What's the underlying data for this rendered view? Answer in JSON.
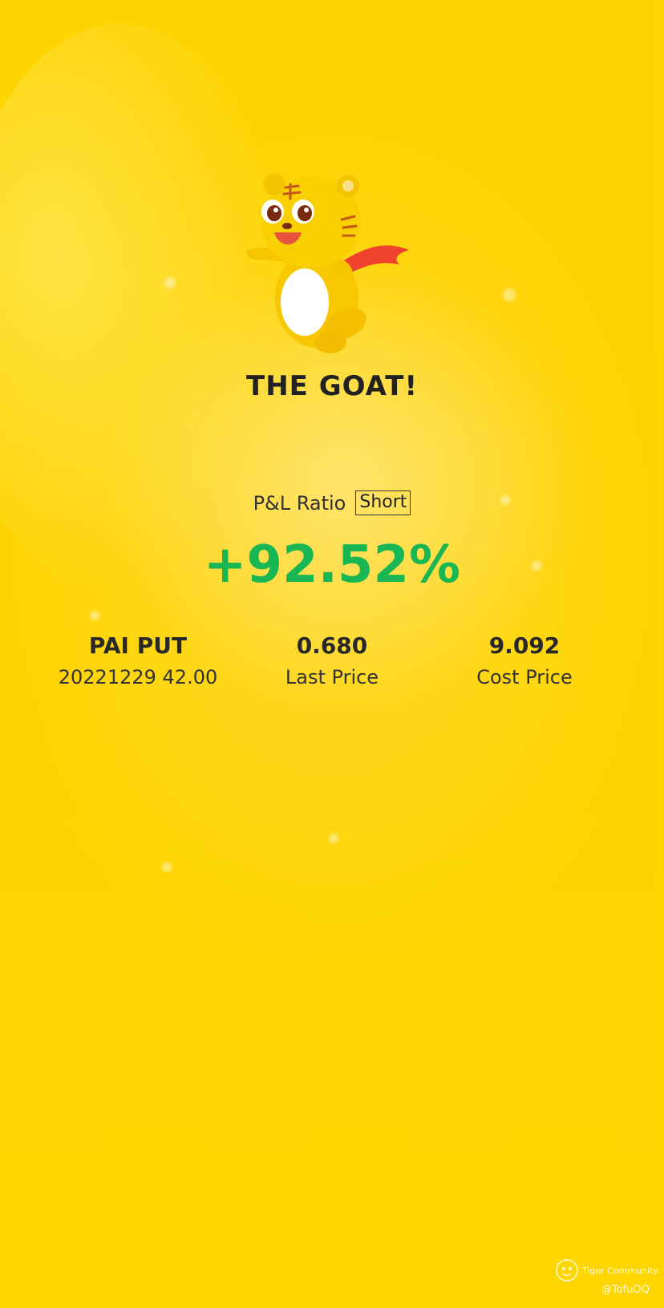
{
  "header": {
    "title": "THE GOAT!"
  },
  "pl": {
    "label": "P&L Ratio",
    "badge": "Short",
    "value": "+92.52%"
  },
  "stats": {
    "contract": {
      "name": "PAI PUT",
      "detail": "20221229 42.00"
    },
    "last_price": {
      "value": "0.680",
      "label": "Last Price"
    },
    "cost_price": {
      "value": "9.092",
      "label": "Cost Price"
    }
  },
  "footer": {
    "brand": "Tiger Community",
    "user": "@TofuOQ"
  },
  "colors": {
    "background": "#fdd300",
    "gain": "#18b754",
    "text": "#222222",
    "mascot_scarf": "#f0432e"
  },
  "icons": {
    "mascot": "tiger-mascot-icon",
    "brand_logo": "tiger-logo-icon"
  }
}
